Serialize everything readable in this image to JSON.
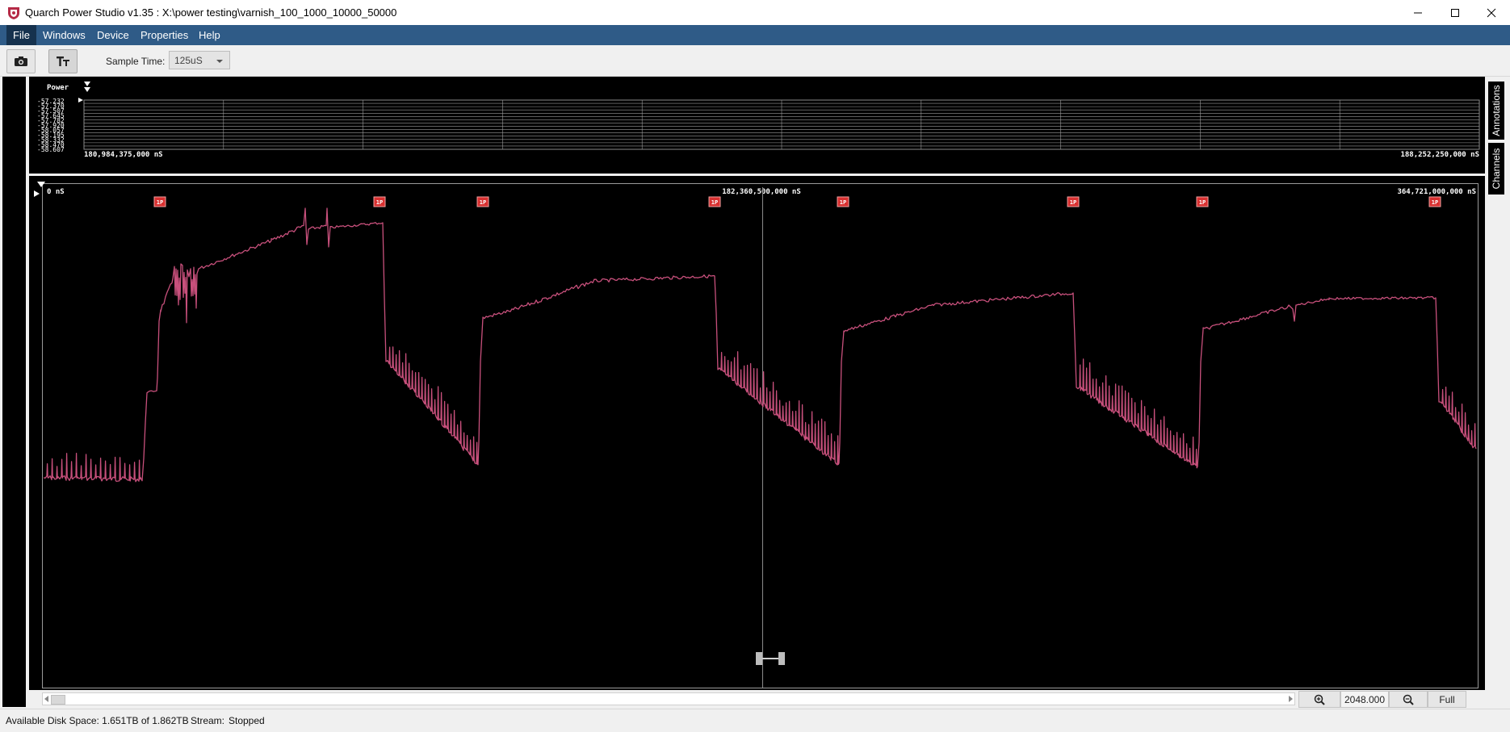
{
  "window": {
    "title": "Quarch Power Studio v1.35 : X:\\power testing\\varnish_100_1000_10000_50000"
  },
  "menu": {
    "items": [
      {
        "label": "File"
      },
      {
        "label": "Windows"
      },
      {
        "label": "Device"
      },
      {
        "label": "Properties"
      },
      {
        "label": "Help"
      }
    ]
  },
  "toolbar": {
    "sample_time_label": "Sample Time:",
    "sample_time_value": "125uS"
  },
  "overview": {
    "channel_label": "Power",
    "y_ticks": [
      "57.232",
      "57.370",
      "57.507",
      "57.645",
      "57.782",
      "57.920",
      "58.057",
      "58.195",
      "58.332",
      "58.470",
      "58.607"
    ],
    "start_time": "180,984,375,000 nS",
    "end_time": "188,252,250,000 nS"
  },
  "main_plot": {
    "start_time": "0 nS",
    "center_time": "182,360,500,000 nS",
    "end_time": "364,721,000,000 nS",
    "marker_label": "1P"
  },
  "side_tabs": {
    "annotations": "Annotations",
    "channels": "Channels"
  },
  "zoom": {
    "value": "2048.000",
    "full_label": "Full"
  },
  "status": {
    "disk_space": "Available Disk Space: 1.651TB of 1.862TB",
    "stream_label": "Stream:",
    "stream_value": "Stopped"
  },
  "colors": {
    "menu_bar": "#2f5b87",
    "trace": "#c8507c",
    "plot_background": "#000000",
    "grid": "#ffffff",
    "marker": "#d83030"
  }
}
